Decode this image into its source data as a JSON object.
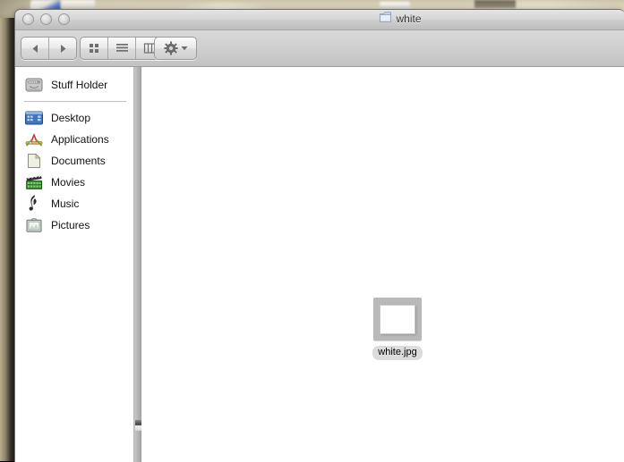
{
  "window": {
    "title": "white",
    "title_icon": "folder-icon",
    "traffic_lights": [
      {
        "name": "close-button",
        "label": "Close"
      },
      {
        "name": "minimize-button",
        "label": "Minimize"
      },
      {
        "name": "zoom-button",
        "label": "Zoom"
      }
    ]
  },
  "toolbar": {
    "back_label": "◀",
    "forward_label": "▶",
    "views": [
      {
        "name": "icon-view-button",
        "label": "Icon View"
      },
      {
        "name": "list-view-button",
        "label": "List View"
      },
      {
        "name": "column-view-button",
        "label": "Column View"
      }
    ],
    "action_label": "Action",
    "action_chevron": "▾"
  },
  "sidebar": {
    "devices": [
      {
        "label": "Stuff Holder",
        "icon": "hard-drive-icon"
      }
    ],
    "places": [
      {
        "label": "Desktop",
        "icon": "desktop-icon"
      },
      {
        "label": "Applications",
        "icon": "applications-icon"
      },
      {
        "label": "Documents",
        "icon": "documents-icon"
      },
      {
        "label": "Movies",
        "icon": "movies-icon"
      },
      {
        "label": "Music",
        "icon": "music-icon"
      },
      {
        "label": "Pictures",
        "icon": "pictures-icon"
      }
    ]
  },
  "content": {
    "files": [
      {
        "name": "white.jpg",
        "icon": "image-file-icon"
      }
    ]
  },
  "colors": {
    "titlebar": "#d7d7d7",
    "toolbar": "#cfcfcf",
    "content_bg": "#ffffff",
    "divider": "#b2b2b2",
    "label_bg": "#dcdcdc",
    "desktop": "#ddd6bd"
  }
}
